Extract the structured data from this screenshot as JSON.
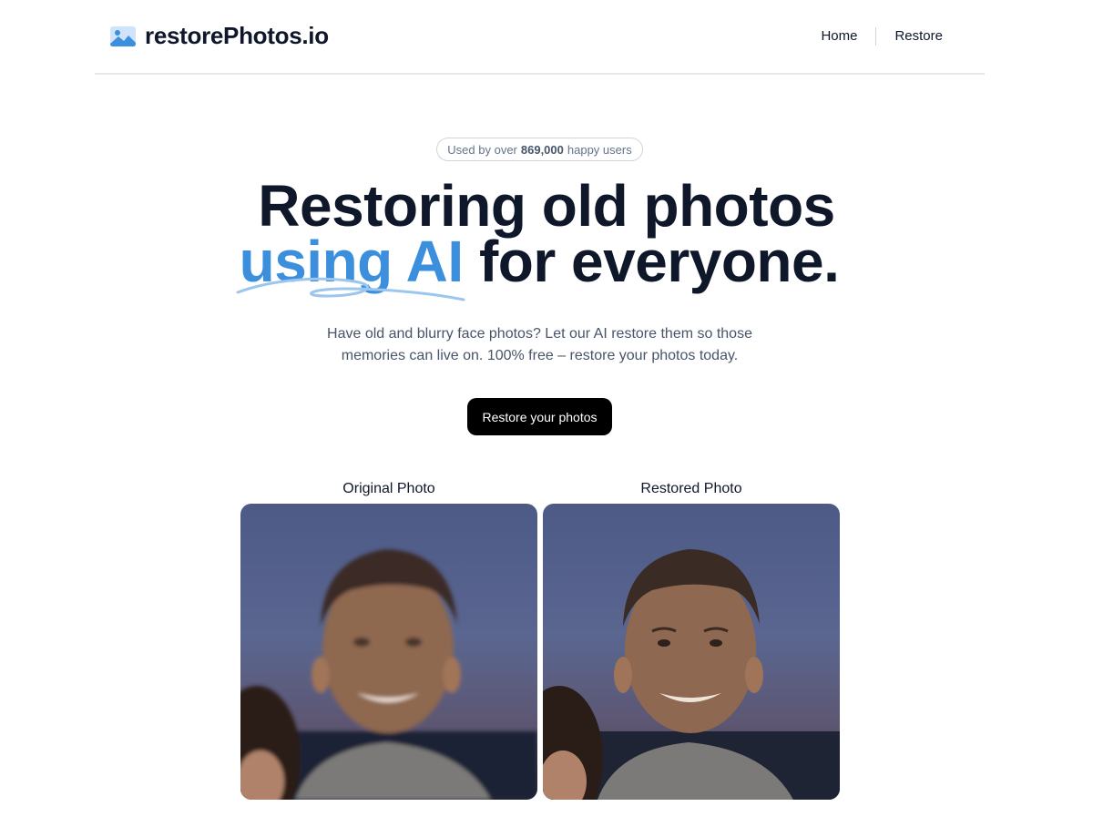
{
  "header": {
    "logo_text": "restorePhotos.io",
    "logo_icon": "photo-icon",
    "nav": [
      {
        "label": "Home"
      },
      {
        "label": "Restore"
      }
    ]
  },
  "badge": {
    "prefix": "Used by over",
    "count": "869,000",
    "suffix": "happy users"
  },
  "hero": {
    "line1": "Restoring old photos",
    "accent": "using AI",
    "line2_rest": "for everyone.",
    "subtitle": "Have old and blurry face photos? Let our AI restore them so those memories can live on. 100% free – restore your photos today.",
    "cta_label": "Restore your photos"
  },
  "comparison": {
    "original_label": "Original Photo",
    "restored_label": "Restored Photo"
  },
  "colors": {
    "accent": "#3b8fdc",
    "button_bg": "#000000",
    "text": "#0f172a"
  }
}
